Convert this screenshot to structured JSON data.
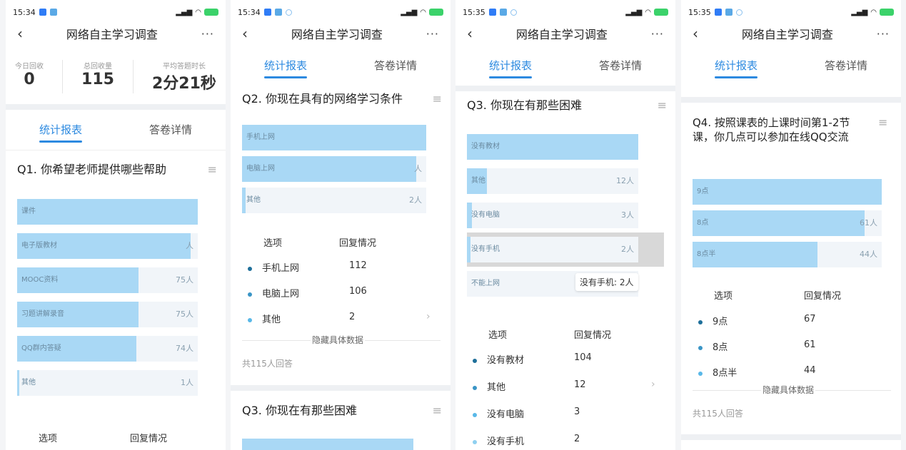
{
  "app": {
    "title": "网络自主学习调查",
    "back_icon": "back-arrow-icon",
    "more_label": "···",
    "tab_stats": "统计报表",
    "tab_detail": "答卷详情"
  },
  "panels": [
    {
      "time": "15:34"
    },
    {
      "time": "15:34"
    },
    {
      "time": "15:35"
    },
    {
      "time": "15:35"
    }
  ],
  "summary": {
    "today_label": "今日回收",
    "today_value": "0",
    "total_label": "总回收量",
    "total_value": "115",
    "avg_label": "平均答题时长",
    "avg_value": "2分21秒"
  },
  "table_headers": {
    "option": "选项",
    "reply": "回复情况"
  },
  "hide_data_label": "隐藏具体数据",
  "total_answers_label": "共115人回答",
  "colors": {
    "accent": "#2d8ae0",
    "bar": "#a9d8f5",
    "bar_bg": "#f1f5f9",
    "dot1": "#1e6f9a",
    "dot2": "#3a95c6",
    "dot3": "#59b8e8",
    "dot4": "#8fd0f0"
  },
  "q1": {
    "title": "Q1. 你希望老师提供哪些帮助",
    "bars": [
      {
        "label": "课件",
        "fill": 1.0,
        "count": ""
      },
      {
        "label": "电子版教材",
        "fill": 0.96,
        "count": "人"
      },
      {
        "label": "MOOC资料",
        "fill": 0.67,
        "count": "75人"
      },
      {
        "label": "习题讲解录音",
        "fill": 0.67,
        "count": "75人"
      },
      {
        "label": "QQ群内答疑",
        "fill": 0.66,
        "count": "74人"
      },
      {
        "label": "其他",
        "fill": 0.01,
        "count": "1人"
      }
    ]
  },
  "q2": {
    "title": "Q2. 你现在具有的网络学习条件",
    "bars": [
      {
        "label": "手机上网",
        "fill": 1.0,
        "count": ""
      },
      {
        "label": "电脑上网",
        "fill": 0.945,
        "count": "人"
      },
      {
        "label": "其他",
        "fill": 0.018,
        "count": "2人"
      }
    ],
    "rows": [
      {
        "option": "手机上网",
        "reply": "112"
      },
      {
        "option": "电脑上网",
        "reply": "106"
      },
      {
        "option": "其他",
        "reply": "2"
      }
    ]
  },
  "q3": {
    "title": "Q3. 你现在有那些困难",
    "bars": [
      {
        "label": "没有教材",
        "fill": 1.0,
        "count": ""
      },
      {
        "label": "其他",
        "fill": 0.115,
        "count": "12人"
      },
      {
        "label": "没有电脑",
        "fill": 0.029,
        "count": "3人"
      },
      {
        "label": "没有手机",
        "fill": 0.019,
        "count": "2人"
      },
      {
        "label": "不能上网",
        "fill": 0.0,
        "count": ""
      }
    ],
    "tooltip": "没有手机: 2人",
    "rows": [
      {
        "option": "没有教材",
        "reply": "104"
      },
      {
        "option": "其他",
        "reply": "12"
      },
      {
        "option": "没有电脑",
        "reply": "3"
      },
      {
        "option": "没有手机",
        "reply": "2"
      }
    ]
  },
  "q4": {
    "title": "Q4. 按照课表的上课时间第1-2节课，你几点可以参加在线QQ交流",
    "bars": [
      {
        "label": "9点",
        "fill": 1.0,
        "count": ""
      },
      {
        "label": "8点",
        "fill": 0.91,
        "count": "61人"
      },
      {
        "label": "8点半",
        "fill": 0.66,
        "count": "44人"
      }
    ],
    "rows": [
      {
        "option": "9点",
        "reply": "67"
      },
      {
        "option": "8点",
        "reply": "61"
      },
      {
        "option": "8点半",
        "reply": "44"
      }
    ]
  }
}
